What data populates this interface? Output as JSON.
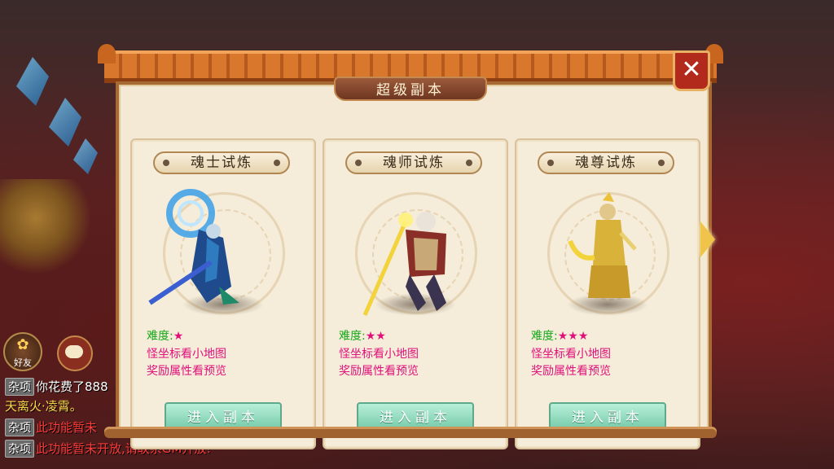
{
  "dialog": {
    "title": "超级副本",
    "close_label": "✕"
  },
  "dungeons": [
    {
      "name": "魂士试炼",
      "difficulty_label": "难度:",
      "stars": "★",
      "star_count": 1,
      "info_line1": "怪坐标看小地图",
      "info_line2": "奖励属性看预览",
      "enter_label": "进入副本"
    },
    {
      "name": "魂师试炼",
      "difficulty_label": "难度:",
      "stars": "★★",
      "star_count": 2,
      "info_line1": "怪坐标看小地图",
      "info_line2": "奖励属性看预览",
      "enter_label": "进入副本"
    },
    {
      "name": "魂尊试炼",
      "difficulty_label": "难度:",
      "stars": "★★★",
      "star_count": 3,
      "info_line1": "怪坐标看小地图",
      "info_line2": "奖励属性看预览",
      "enter_label": "进入副本"
    }
  ],
  "chat": {
    "friend_label": "好友",
    "messages": [
      {
        "tag": "杂项",
        "text": "你花费了888"
      },
      {
        "tag": "",
        "text": "天离火·凌霄。"
      },
      {
        "tag": "杂项",
        "text": "此功能暂未"
      },
      {
        "tag": "杂项",
        "text": "此功能暂未开放,请联系GM开放!"
      }
    ]
  },
  "colors": {
    "difficulty": "#17a81a",
    "info": "#e0107a",
    "enter_button": "#6fc7a4",
    "roof": "#d9772c"
  },
  "icons": [
    "close-icon",
    "next-arrow-icon",
    "chat-icon",
    "gear-icon",
    "friend-icon"
  ]
}
